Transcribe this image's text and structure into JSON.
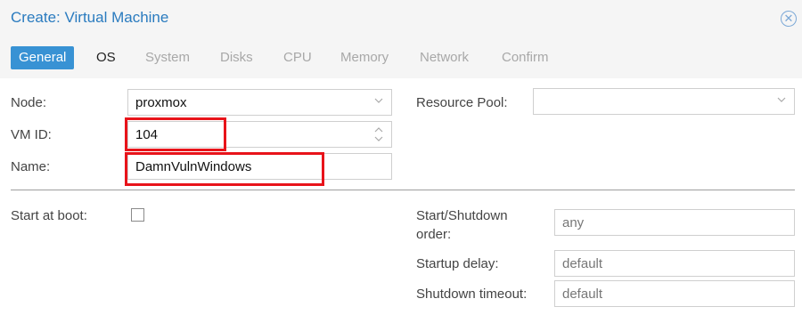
{
  "window": {
    "title": "Create: Virtual Machine"
  },
  "tabs": [
    "General",
    "OS",
    "System",
    "Disks",
    "CPU",
    "Memory",
    "Network",
    "Confirm"
  ],
  "general": {
    "node_label": "Node:",
    "node_value": "proxmox",
    "vmid_label": "VM ID:",
    "vmid_value": "104",
    "name_label": "Name:",
    "name_value": "DamnVulnWindows",
    "resource_pool_label": "Resource Pool:",
    "resource_pool_value": "",
    "start_at_boot_label": "Start at boot:",
    "start_at_boot_checked": false,
    "start_shutdown_order_label_1": "Start/Shutdown",
    "start_shutdown_order_label_2": "order:",
    "start_shutdown_order_value": "any",
    "startup_delay_label": "Startup delay:",
    "startup_delay_value": "default",
    "shutdown_timeout_label": "Shutdown timeout:",
    "shutdown_timeout_value": "default"
  },
  "icons": {
    "close": "close-circle-icon",
    "dropdown": "chevron-down-icon",
    "spinner": "spinner-updown-icon"
  },
  "colors": {
    "accent": "#3892d4",
    "title": "#2a7bbf",
    "highlight": "#e8131a"
  }
}
